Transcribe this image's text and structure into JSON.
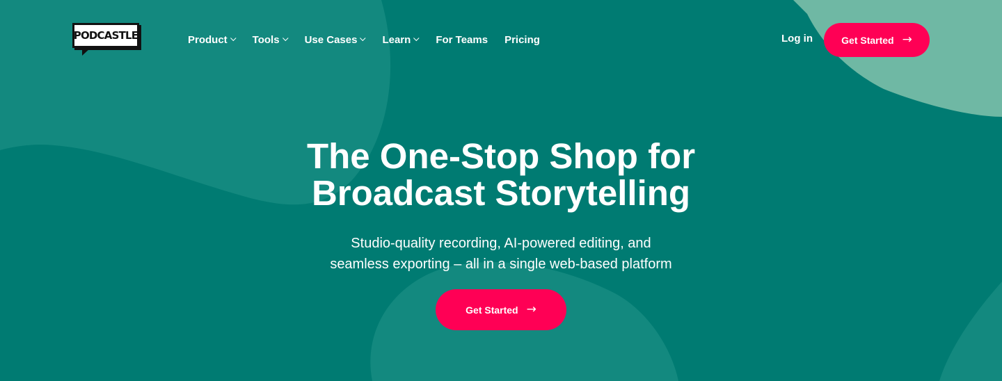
{
  "brand": {
    "logo_text": "PODCASTLE"
  },
  "nav": {
    "items": [
      {
        "label": "Product",
        "has_dropdown": true
      },
      {
        "label": "Tools",
        "has_dropdown": true
      },
      {
        "label": "Use Cases",
        "has_dropdown": true
      },
      {
        "label": "Learn",
        "has_dropdown": true
      },
      {
        "label": "For Teams",
        "has_dropdown": false
      },
      {
        "label": "Pricing",
        "has_dropdown": false
      }
    ],
    "login_label": "Log in",
    "cta_label": "Get Started"
  },
  "hero": {
    "title_line1": "The One-Stop Shop for",
    "title_line2": "Broadcast Storytelling",
    "subtitle_line1": "Studio-quality recording, AI-powered editing, and",
    "subtitle_line2": "seamless exporting – all in a single web-based platform",
    "cta_label": "Get Started"
  },
  "colors": {
    "background": "#007b72",
    "blob_light": "#6fb8a4",
    "blob_mid": "#13897f",
    "accent": "#ff0055"
  }
}
